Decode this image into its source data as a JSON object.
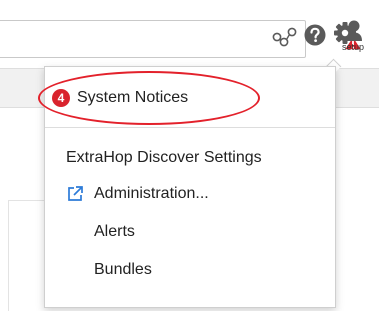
{
  "toolbar": {
    "search_value": "",
    "icons": [
      "network-icon",
      "help-icon",
      "settings-alert-icon",
      "user-icon"
    ],
    "user_label": "setup"
  },
  "notices": {
    "count": "4",
    "label": "System Notices"
  },
  "menu": {
    "section_title": "ExtraHop Discover Settings",
    "items": [
      {
        "label": "Administration...",
        "icon": "external-link-icon"
      },
      {
        "label": "Alerts"
      },
      {
        "label": "Bundles"
      }
    ]
  },
  "colors": {
    "alert_red": "#d9232d",
    "icon_gray": "#5a5a5a",
    "link_blue": "#2c7bd8"
  }
}
